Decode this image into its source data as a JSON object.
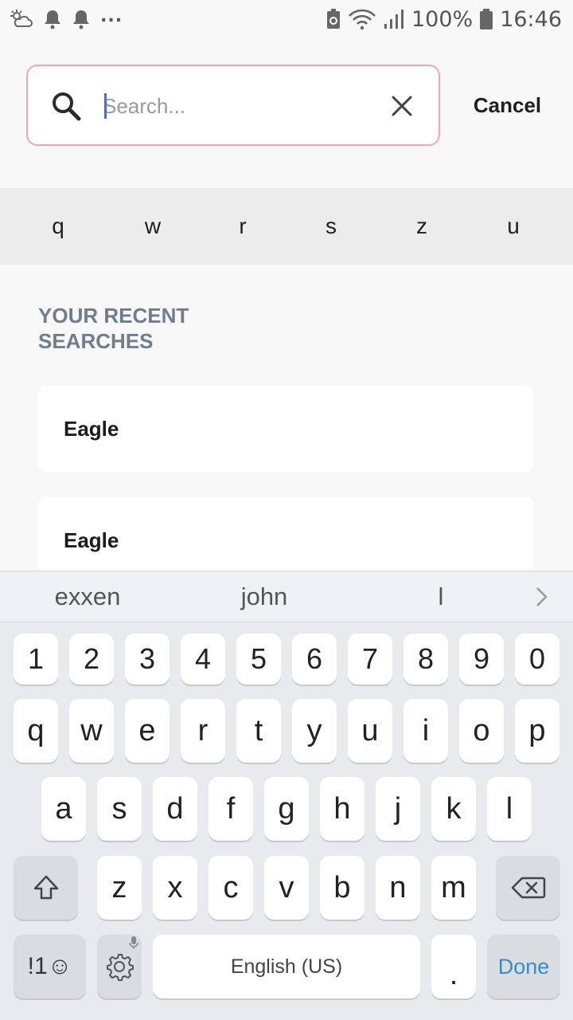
{
  "status_bar": {
    "battery": "100%",
    "time": "16:46",
    "overflow": "..."
  },
  "search": {
    "placeholder": "Search...",
    "value": "",
    "cancel_label": "Cancel"
  },
  "letter_filter": [
    "q",
    "w",
    "r",
    "s",
    "z",
    "u"
  ],
  "recent": {
    "title_line1": "YOUR RECENT",
    "title_line2": "SEARCHES",
    "items": [
      "Eagle",
      "Eagle"
    ]
  },
  "keyboard": {
    "suggestions": [
      "exxen",
      "john",
      "l"
    ],
    "number_row": [
      "1",
      "2",
      "3",
      "4",
      "5",
      "6",
      "7",
      "8",
      "9",
      "0"
    ],
    "row1": [
      "q",
      "w",
      "e",
      "r",
      "t",
      "y",
      "u",
      "i",
      "o",
      "p"
    ],
    "row2": [
      "a",
      "s",
      "d",
      "f",
      "g",
      "h",
      "j",
      "k",
      "l"
    ],
    "row3": [
      "z",
      "x",
      "c",
      "v",
      "b",
      "n",
      "m"
    ],
    "symbols_label": "!1☺",
    "space_label": "English (US)",
    "period_label": ".",
    "done_label": "Done"
  },
  "colors": {
    "caret": "#3b6ef3",
    "search_border": "#efa6b0",
    "done_text": "#3a8cc9",
    "section_title": "#6f7d8c"
  }
}
